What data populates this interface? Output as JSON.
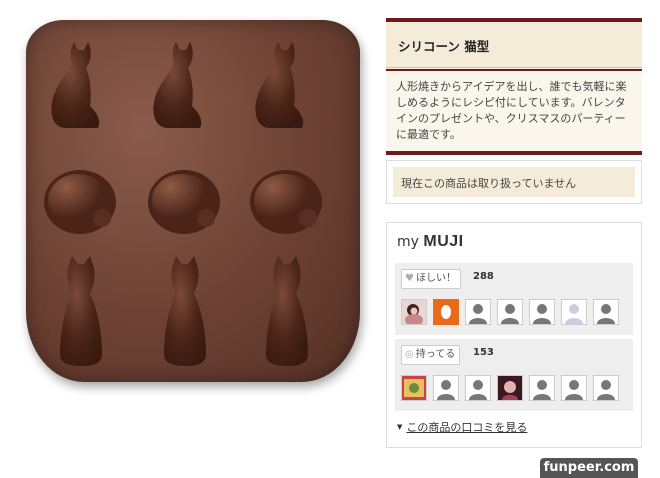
{
  "product": {
    "title": "シリコーン 猫型",
    "description": "人形焼きからアイデアを出し、誰でも気軽に楽しめるようにレシピ付にしています。バレンタインのプレゼントや、クリスマスのパーティーに最適です。",
    "image": "cat-shaped-silicone-mold",
    "notice": "現在この商品は取り扱っていません"
  },
  "mymuji": {
    "title_prefix": "my",
    "title_brand": "MUJI",
    "want": {
      "label": "ほしい！",
      "icon": "heart-icon",
      "count": "288"
    },
    "have": {
      "label": "持ってる",
      "icon": "circle-icon",
      "count": "153"
    },
    "review_link": "この商品の口コミを見る"
  },
  "watermark": "funpeer.com",
  "colors": {
    "accent": "#6c1a1f",
    "panel_bg": "#f4ecd8",
    "mold": "#6c4133"
  }
}
